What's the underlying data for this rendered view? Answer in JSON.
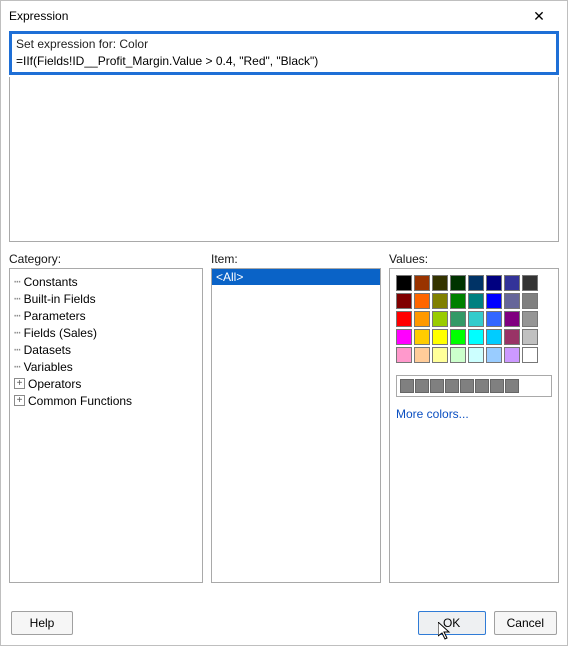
{
  "window": {
    "title": "Expression",
    "close_glyph": "✕"
  },
  "expr": {
    "set_for_label": "Set expression for: Color",
    "value": "=IIf(Fields!ID__Profit_Margin.Value > 0.4, \"Red\", \"Black\")"
  },
  "panels": {
    "category_label": "Category:",
    "item_label": "Item:",
    "values_label": "Values:",
    "categories": [
      {
        "text": "Constants",
        "expander": ""
      },
      {
        "text": "Built-in Fields",
        "expander": ""
      },
      {
        "text": "Parameters",
        "expander": ""
      },
      {
        "text": "Fields (Sales)",
        "expander": ""
      },
      {
        "text": "Datasets",
        "expander": ""
      },
      {
        "text": "Variables",
        "expander": ""
      },
      {
        "text": "Operators",
        "expander": "+"
      },
      {
        "text": "Common Functions",
        "expander": "+"
      }
    ],
    "item_selected": "<All>",
    "more_colors": "More colors...",
    "swatches": [
      [
        "#000000",
        "#993300",
        "#333300",
        "#003300",
        "#003366",
        "#000080",
        "#333399",
        "#333333"
      ],
      [
        "#800000",
        "#ff6600",
        "#808000",
        "#008000",
        "#008080",
        "#0000ff",
        "#666699",
        "#808080"
      ],
      [
        "#ff0000",
        "#ff9900",
        "#99cc00",
        "#339966",
        "#33cccc",
        "#3366ff",
        "#800080",
        "#969696"
      ],
      [
        "#ff00ff",
        "#ffcc00",
        "#ffff00",
        "#00ff00",
        "#00ffff",
        "#00ccff",
        "#993366",
        "#c0c0c0"
      ],
      [
        "#ff99cc",
        "#ffcc99",
        "#ffff99",
        "#ccffcc",
        "#ccffff",
        "#99ccff",
        "#cc99ff",
        "#ffffff"
      ]
    ]
  },
  "buttons": {
    "help": "Help",
    "ok": "OK",
    "cancel": "Cancel"
  }
}
